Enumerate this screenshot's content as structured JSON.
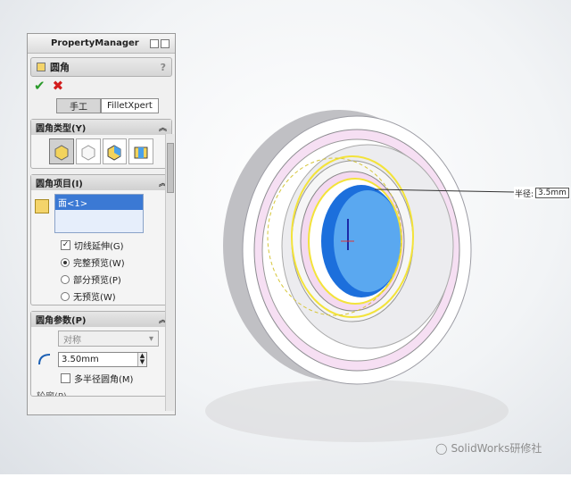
{
  "panel": {
    "title": "PropertyManager",
    "feature_title": "圆角",
    "help": "?",
    "ok": "✔",
    "cancel": "✖",
    "tabs": {
      "manual": "手工",
      "expert": "FilletXpert"
    },
    "type_group": {
      "label": "圆角类型(Y)"
    },
    "items_group": {
      "label": "圆角项目(I)",
      "list_item": "面<1>"
    },
    "options": {
      "tangent": "切线延伸(G)",
      "full": "完整预览(W)",
      "partial": "部分预览(P)",
      "none": "无预览(W)"
    },
    "params_group": {
      "label": "圆角参数(P)",
      "symmetry": "对称",
      "radius": "3.50mm",
      "multi": "多半径圆角(M)",
      "cut_label": "轮廓(P)"
    }
  },
  "dimension": {
    "label": "半径:",
    "value": "3.5mm"
  },
  "watermark": "SolidWorks研修社"
}
